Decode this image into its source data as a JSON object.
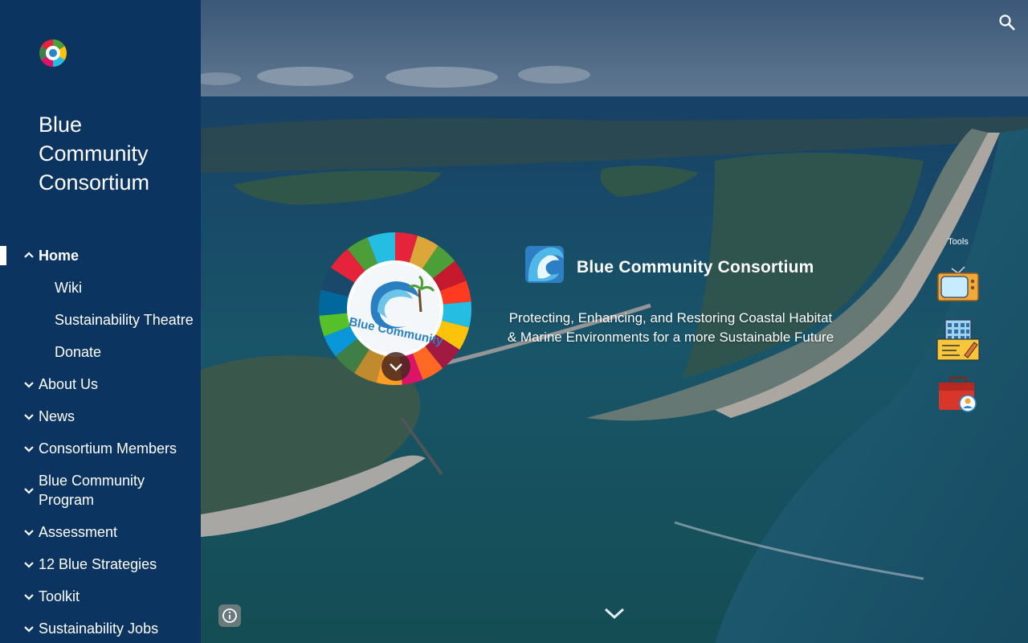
{
  "sidebar": {
    "site_title": "Blue Community Consortium",
    "items": [
      {
        "label": "Home",
        "icon": "chevron-up-icon",
        "active": true
      },
      {
        "label": "Wiki",
        "sub": true
      },
      {
        "label": "Sustainability Theatre",
        "sub": true
      },
      {
        "label": "Donate",
        "sub": true
      },
      {
        "label": "About Us",
        "icon": "chevron-down-icon"
      },
      {
        "label": "News",
        "icon": "chevron-down-icon"
      },
      {
        "label": "Consortium Members",
        "icon": "chevron-down-icon"
      },
      {
        "label": "Blue Community Program",
        "icon": "chevron-down-icon"
      },
      {
        "label": "Assessment",
        "icon": "chevron-down-icon"
      },
      {
        "label": "12 Blue Strategies",
        "icon": "chevron-down-icon"
      },
      {
        "label": "Toolkit",
        "icon": "chevron-down-icon"
      },
      {
        "label": "Sustainability Jobs",
        "icon": "chevron-down-icon"
      }
    ]
  },
  "hero": {
    "title": "Blue Community Consortium",
    "subtitle_line1": "Protecting, Enhancing, and Restoring Coastal Habitat",
    "subtitle_line2": "& Marine Environments for a more Sustainable Future",
    "wheel_text": "Blue Community"
  },
  "tools": {
    "label": "Tools"
  },
  "icons": {
    "search": "search-icon",
    "info": "info-icon",
    "scroll": "chevron-down-icon"
  },
  "colors": {
    "sidebar_bg": "#0c3460",
    "accent_white": "#ffffff"
  }
}
